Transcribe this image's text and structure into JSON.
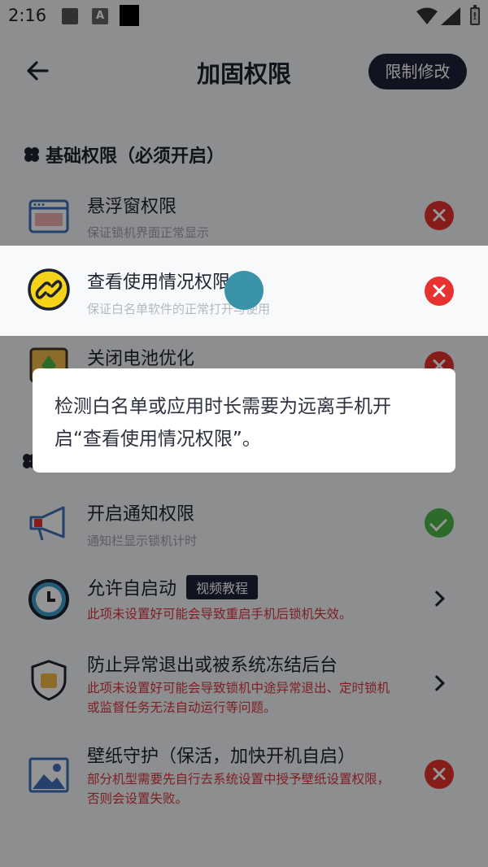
{
  "status_bar": {
    "time": "2:16",
    "battery_mark": "!"
  },
  "header": {
    "title": "加固权限",
    "limit_button": "限制修改"
  },
  "section_basic": {
    "title": "基础权限（必须开启）"
  },
  "rows": [
    {
      "title": "悬浮窗权限",
      "subtitle": "保证锁机界面正常显示",
      "status": "error"
    },
    {
      "title": "查看使用情况权限",
      "subtitle": "保证白名单软件的正常打开与使用",
      "status": "error"
    },
    {
      "title": "关闭电池优化",
      "subtitle": "",
      "status": "error"
    },
    {
      "title": "开启通知权限",
      "subtitle": "通知栏显示锁机计时",
      "status": "ok"
    },
    {
      "title": "允许自启动",
      "badge": "视频教程",
      "warning": "此项未设置好可能会导致重启手机后锁机失效。",
      "status": "chevron"
    },
    {
      "title": "防止异常退出或被系统冻结后台",
      "warning": "此项未设置好可能会导致锁机中途异常退出、定时锁机或监督任务无法自动运行等问题。",
      "status": "chevron"
    },
    {
      "title": "壁纸守护（保活，加快开机自启）",
      "warning": "部分机型需要先自行去系统设置中授予壁纸设置权限，否则会设置失败。",
      "status": "error"
    }
  ],
  "tooltip": {
    "text": "检测白名单或应用时长需要为远离手机开启“查看使用情况权限”。"
  },
  "colors": {
    "accent_dark": "#20223a",
    "error": "#e8322f",
    "ok": "#4cb848",
    "warning_text": "#d9363e"
  }
}
